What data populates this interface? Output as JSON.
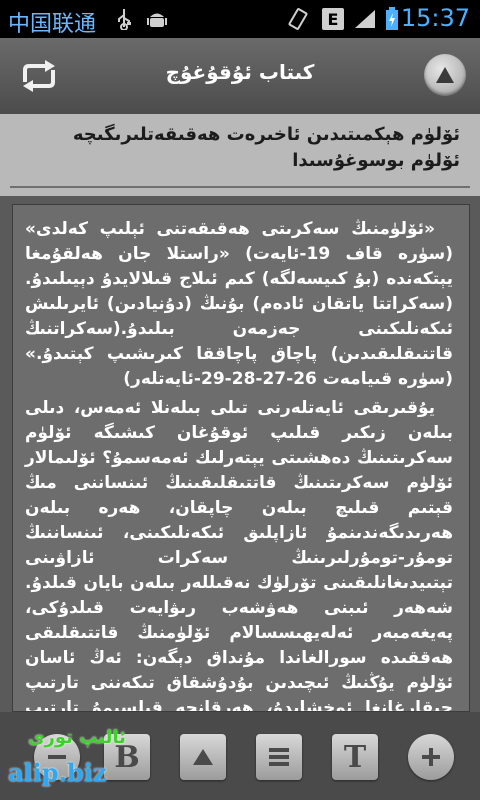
{
  "status_bar": {
    "carrier": "中国联通",
    "network_type": "E",
    "time": "15:37"
  },
  "header": {
    "title": "كىتاب ئۇقۇغۇچ"
  },
  "chapter": {
    "title": "ئۆلۈم ھېكمىتىدىن ئاخىرەت ھەقىقەتلىرىگىچە ئۆلۈم بوسوغۇسىدا"
  },
  "content": {
    "paragraphs": [
      "«ئۆلۈمنىڭ سەكرىتى ھەقىقەتنى ئېلىپ كەلدى» (سۈرە قاف 19-ئايەت) «راستلا جان ھەلقۇمغا يېتكەندە (بۇ كىيسەلگە) كىم ئىلاج قىلالايدۇ دېيىلىدۇ. (سەكراتتا ياتقان ئادەم) بۇنىڭ (دۇنيادىن) ئايرىلىش ئىكەنلىكىنى جەزمەن بىلىدۇ.(سەكراتنىڭ قاتتىقلىقىدىن) پاچاق پاچاققا كىرىشىپ كېتىدۇ.» (سۈرە قىيامەت 26-27-28-29-ئايەتلەر)",
      "يۇقىرىقى ئايەتلەرنى تىلى بىلەنلا ئەمەس، دىلى بىلەن زىكىر قىلىپ ئوقۇغان كىشىگە ئۆلۈم سەكرىتىنىڭ دەھشىتى يېتەرلىك ئەمەسمۇ؟ ئۆلىمالار ئۆلۈم سەكرىتىنىڭ قاتتىقلىقىنىڭ ئىنساننى مىڭ قېتىم قىلىچ بىلەن چاپقان، ھەرە بىلەن ھەرىدىگەندىنمۇ ئازاپلىق ئىكەنلىكىنى، ئىنساننىڭ تومۇر-تومۇرلىرىنىڭ سەكرات ئازاۋىنى تېتىيدىغانلىقىنى تۆرلۈك نەقىللەر بىلەن بايان قىلدۇ. شەھەر ئىبنى ھەۋشەب رىۋايەت قىلدۇكى، پەيغەمبەر ئەلەيھىسسالام ئۆلۈمنىڭ قاتتىقلىقى ھەققىدە سورالغاندا مۇنداق دېگەن: ئەڭ ئاسان ئۆلۈم يۇڭنىڭ ئىچىدىن بۇدۇشقاق تىكەننى تارتىپ چىقارغانغا ئوخشايدۇ، ھەرقانچە قىلسىمۇ تارتىپ چىقىرىلغان بۇدۇشقاقتا ھامان يۇڭ يېپىشقان بولىدۇ.شۇغا"
    ]
  },
  "toolbar": {
    "bold_label": "B",
    "text_label": "T"
  },
  "watermark": {
    "ug": "ئالىپ تورى",
    "en": "alip.biz"
  },
  "colors": {
    "status_clock": "#4ab0ff",
    "watermark_green": "#3ed12a",
    "watermark_blue": "#2ea8f0"
  }
}
